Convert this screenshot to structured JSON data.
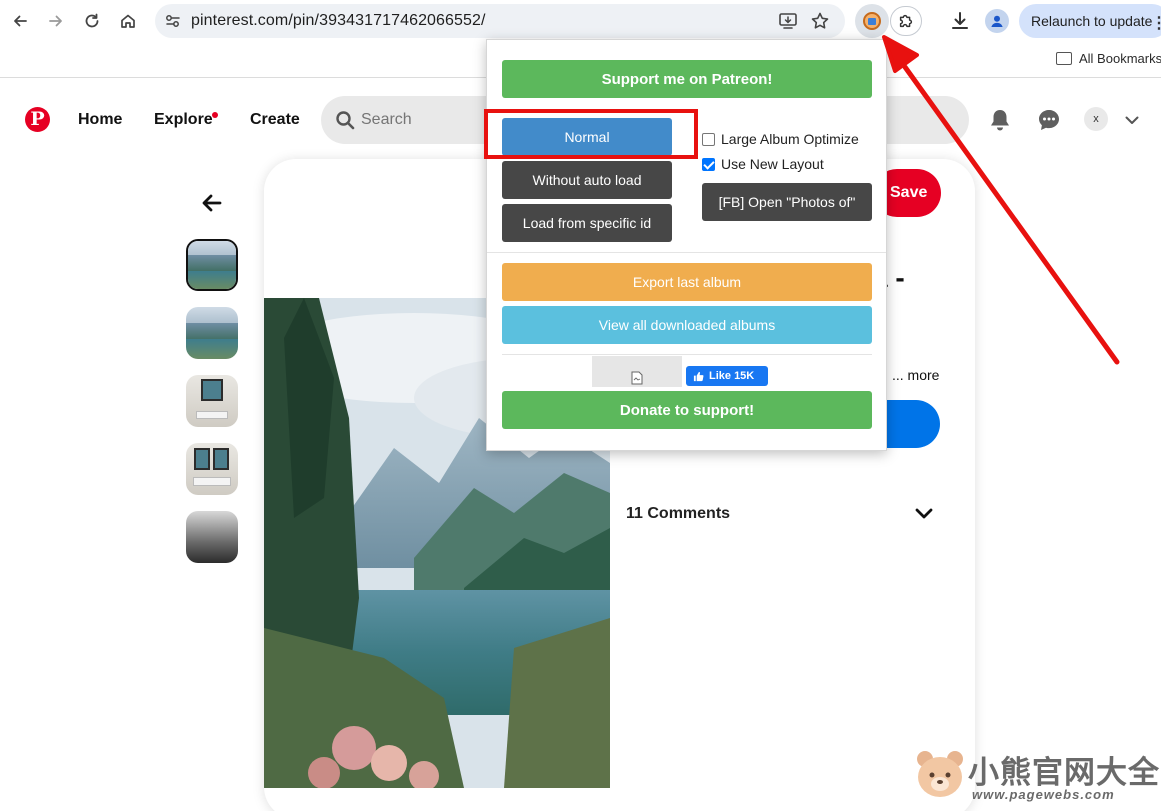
{
  "browser": {
    "url": "pinterest.com/pin/393431717462066552/",
    "relaunch_label": "Relaunch to update",
    "all_bookmarks_label": "All Bookmarks"
  },
  "pinterest": {
    "logo_letter": "P",
    "nav": {
      "home": "Home",
      "explore": "Explore",
      "create": "Create"
    },
    "search_placeholder": "Search",
    "avatar_initial": "x",
    "save_label": "Save",
    "title_fragment": "a -",
    "more_label": "... more",
    "comments_label": "11 Comments"
  },
  "extension_popup": {
    "patreon_label": "Support me on Patreon!",
    "normal_label": "Normal",
    "without_auto_load_label": "Without auto load",
    "load_specific_label": "Load from specific id",
    "large_album_label": "Large Album Optimize",
    "large_album_checked": false,
    "new_layout_label": "Use New Layout",
    "new_layout_checked": true,
    "fb_open_label": "[FB] Open \"Photos of\"",
    "export_label": "Export last album",
    "view_downloaded_label": "View all downloaded albums",
    "fb_like_label": "Like 15K",
    "donate_label": "Donate to support!"
  },
  "watermark": {
    "title": "小熊官网大全",
    "url": "www.pagewebs.com"
  },
  "colors": {
    "pinterest_red": "#e60023",
    "annotation_red": "#e8110f",
    "popup_green": "#5cb85c",
    "popup_blue": "#428bca",
    "popup_dark": "#474747",
    "popup_orange": "#f0ad4e",
    "popup_cyan": "#5bc0de"
  }
}
